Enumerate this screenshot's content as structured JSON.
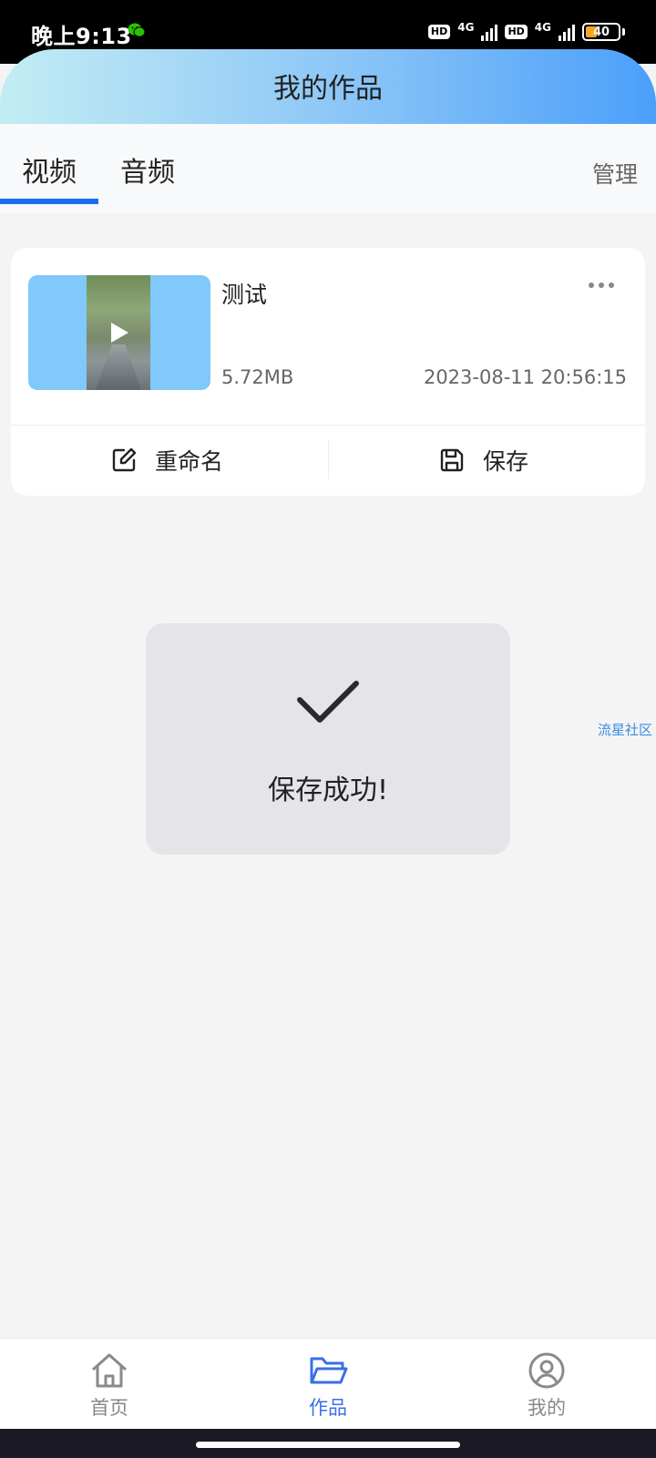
{
  "status_bar": {
    "time": "晚上9:13",
    "hd1": "HD",
    "net1": "4G",
    "hd2": "HD",
    "net2": "4G",
    "battery": "40",
    "battery_color": "#f5a623"
  },
  "header": {
    "title": "我的作品"
  },
  "tabs": {
    "items": [
      {
        "label": "视频",
        "active": true
      },
      {
        "label": "音频",
        "active": false
      }
    ],
    "manage_label": "管理",
    "accent": "#1a6ff0"
  },
  "works": [
    {
      "title": "测试",
      "size": "5.72MB",
      "date": "2023-08-11 20:56:15",
      "thumbnail_icon": "play-icon"
    }
  ],
  "card_actions": {
    "rename_label": "重命名",
    "save_label": "保存"
  },
  "toast": {
    "text": "保存成功!",
    "icon": "check-icon"
  },
  "watermark": "流星社区",
  "bottom_nav": {
    "items": [
      {
        "label": "首页",
        "icon": "home-icon",
        "active": false
      },
      {
        "label": "作品",
        "icon": "folder-icon",
        "active": true
      },
      {
        "label": "我的",
        "icon": "user-icon",
        "active": false
      }
    ],
    "active_color": "#3a6fe8"
  }
}
